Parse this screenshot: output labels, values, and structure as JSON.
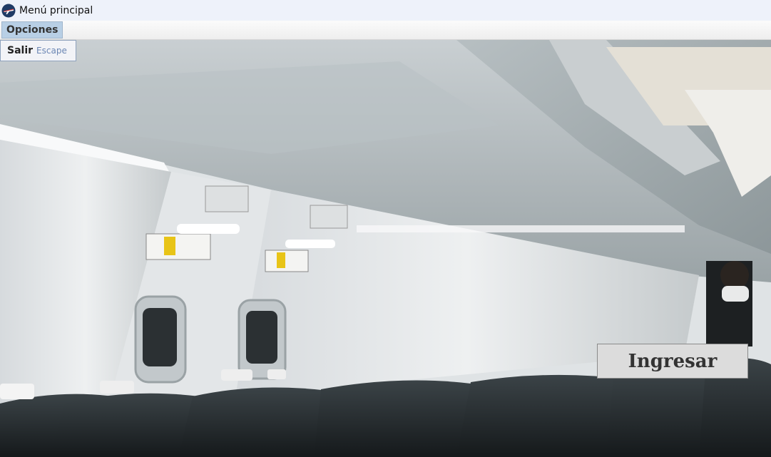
{
  "window": {
    "title": "Menú principal",
    "icon": "airplane-app-icon"
  },
  "menubar": {
    "menus": [
      {
        "label": "Opciones"
      }
    ]
  },
  "dropdown": {
    "items": [
      {
        "label": "Salir",
        "accelerator": "Escape"
      }
    ]
  },
  "main": {
    "background": "airplane-cabin-interior-photo",
    "login_button": {
      "label": "Ingresar"
    }
  },
  "colors": {
    "titlebar_bg": "#eef2fa",
    "menu_highlight": "#b8cfe5",
    "accelerator_text": "#6c87b4",
    "button_bg": "#dcdcdc"
  }
}
